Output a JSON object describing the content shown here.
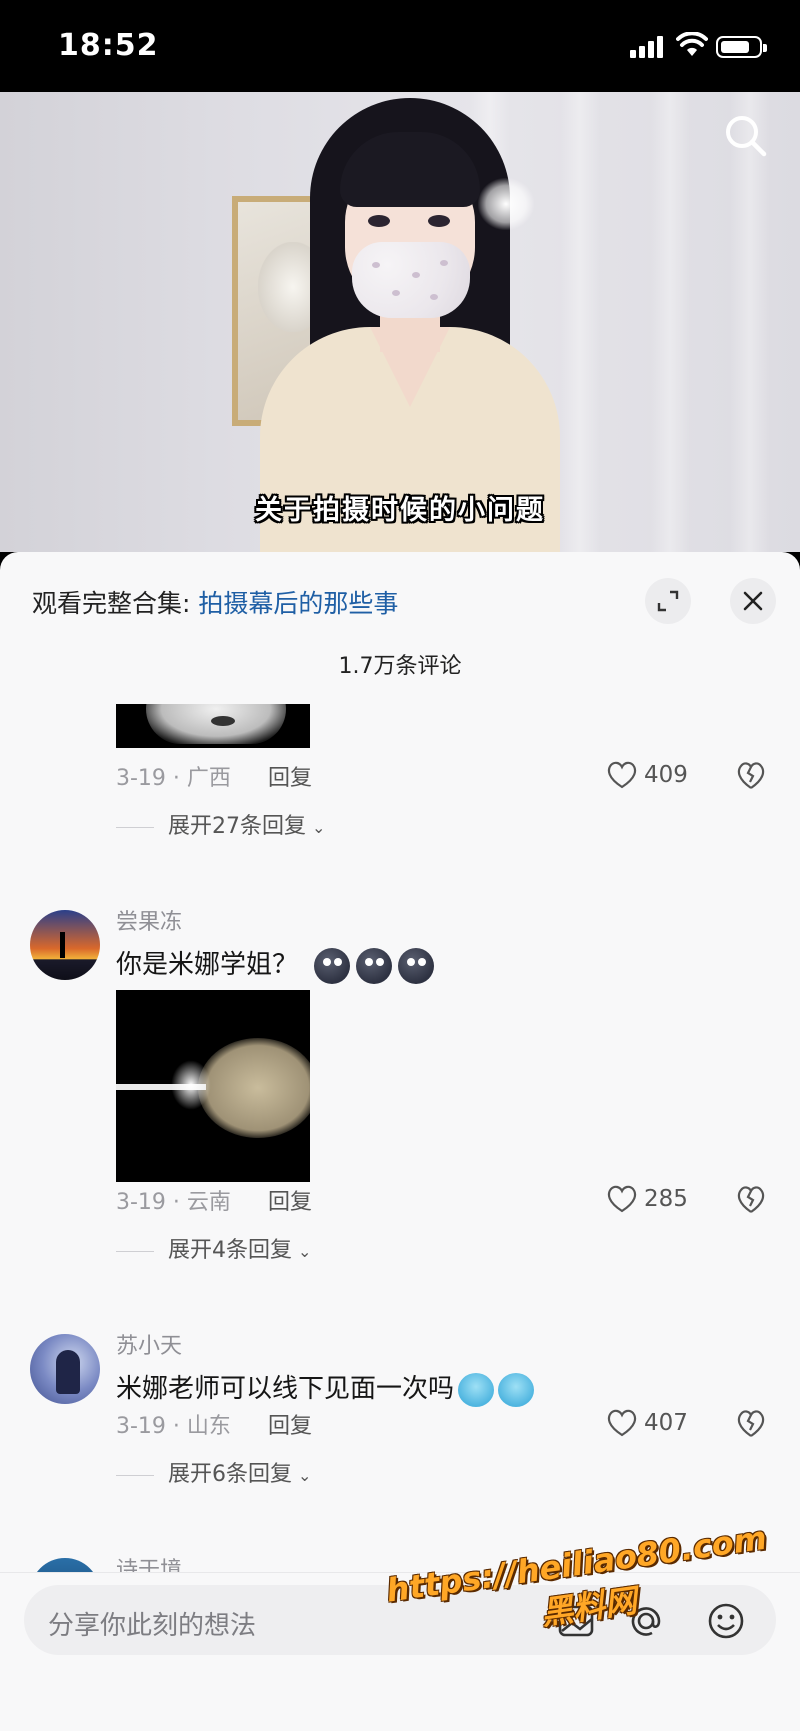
{
  "status_bar": {
    "time": "18:52"
  },
  "video": {
    "subtitle": "关于拍摄时候的小问题"
  },
  "sheet": {
    "collection_prefix": "观看完整合集: ",
    "collection_title": "拍摄幕后的那些事",
    "comment_count": "1.7万条评论"
  },
  "comments": [
    {
      "meta": "3-19 · 广西",
      "reply_label": "回复",
      "likes": "409",
      "expand_label": "展开27条回复"
    },
    {
      "username": "尝果冻",
      "text": "你是米娜学姐？",
      "meta": "3-19 · 云南",
      "reply_label": "回复",
      "likes": "285",
      "expand_label": "展开4条回复"
    },
    {
      "username": "苏小天",
      "text": "米娜老师可以线下见面一次吗",
      "meta": "3-19 · 山东",
      "reply_label": "回复",
      "likes": "407",
      "expand_label": "展开6条回复"
    },
    {
      "username": "诗于境"
    }
  ],
  "input": {
    "placeholder": "分享你此刻的想法"
  },
  "watermark": {
    "url": "https://heiliao80.com",
    "name": "黑料网"
  },
  "colors": {
    "accent_link": "#1f5fa5",
    "sheet_bg": "#f8f8f9"
  },
  "icons": [
    "search-icon",
    "expand-icon",
    "close-icon",
    "heart-icon",
    "broken-heart-icon",
    "chevron-down-icon",
    "image-icon",
    "at-icon",
    "emoji-icon"
  ]
}
